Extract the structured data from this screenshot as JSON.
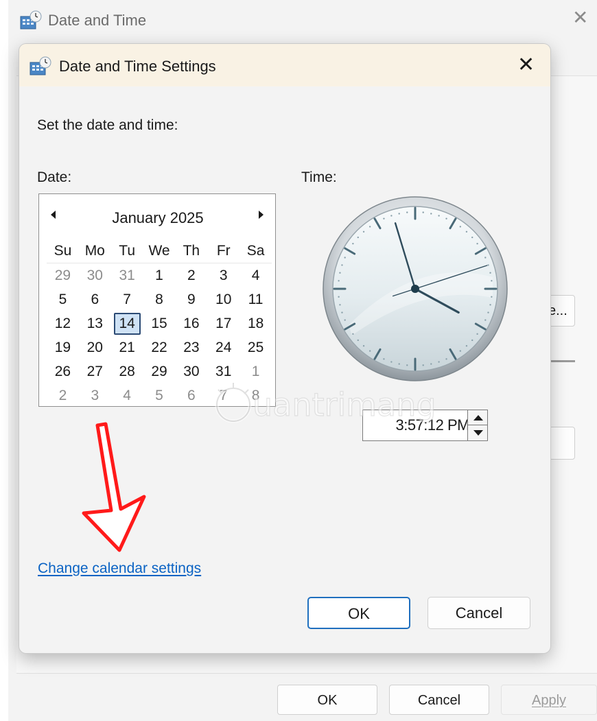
{
  "background_window": {
    "title": "Date and Time",
    "side_button_label": "e...",
    "buttons": {
      "ok": "OK",
      "cancel": "Cancel",
      "apply": "Apply"
    }
  },
  "dialog": {
    "title": "Date and Time Settings",
    "prompt": "Set the date and time:",
    "date_label": "Date:",
    "time_label": "Time:",
    "calendar": {
      "month_year": "January 2025",
      "weekdays": [
        "Su",
        "Mo",
        "Tu",
        "We",
        "Th",
        "Fr",
        "Sa"
      ],
      "weeks": [
        [
          {
            "d": "29",
            "other": true
          },
          {
            "d": "30",
            "other": true
          },
          {
            "d": "31",
            "other": true
          },
          {
            "d": "1"
          },
          {
            "d": "2"
          },
          {
            "d": "3"
          },
          {
            "d": "4"
          }
        ],
        [
          {
            "d": "5"
          },
          {
            "d": "6"
          },
          {
            "d": "7"
          },
          {
            "d": "8"
          },
          {
            "d": "9"
          },
          {
            "d": "10"
          },
          {
            "d": "11"
          }
        ],
        [
          {
            "d": "12"
          },
          {
            "d": "13"
          },
          {
            "d": "14",
            "selected": true
          },
          {
            "d": "15"
          },
          {
            "d": "16"
          },
          {
            "d": "17"
          },
          {
            "d": "18"
          }
        ],
        [
          {
            "d": "19"
          },
          {
            "d": "20"
          },
          {
            "d": "21"
          },
          {
            "d": "22"
          },
          {
            "d": "23"
          },
          {
            "d": "24"
          },
          {
            "d": "25"
          }
        ],
        [
          {
            "d": "26"
          },
          {
            "d": "27"
          },
          {
            "d": "28"
          },
          {
            "d": "29"
          },
          {
            "d": "30"
          },
          {
            "d": "31"
          },
          {
            "d": "1",
            "other": true
          }
        ],
        [
          {
            "d": "2",
            "other": true
          },
          {
            "d": "3",
            "other": true
          },
          {
            "d": "4",
            "other": true
          },
          {
            "d": "5",
            "other": true
          },
          {
            "d": "6",
            "other": true
          },
          {
            "d": "7",
            "other": true
          },
          {
            "d": "8",
            "other": true
          }
        ]
      ]
    },
    "clock": {
      "hour": 3,
      "minute": 57,
      "second": 12
    },
    "time_value": "3:57:12 PM",
    "change_calendar_link": "Change calendar settings",
    "ok_label": "OK",
    "cancel_label": "Cancel"
  },
  "watermark": {
    "text": "uantrimang"
  },
  "colors": {
    "titlebar": "#f9f2e4",
    "link": "#0b63c4",
    "selected_day_bg": "#cfe2f5",
    "selected_day_border": "#2b4a74",
    "annotation_arrow": "#ff1a1a",
    "clock_hand": "#2f4c5c"
  }
}
